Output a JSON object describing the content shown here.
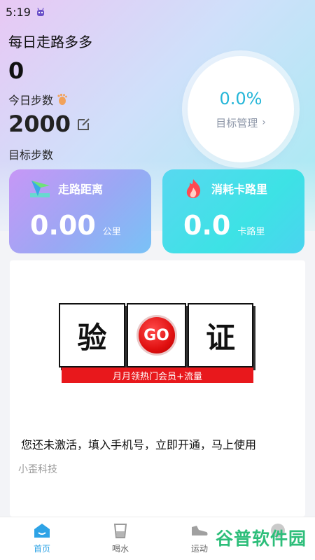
{
  "status_bar": {
    "time": "5:19"
  },
  "header": {
    "app_title": "每日走路多多",
    "steps_today": "0",
    "steps_today_label": "今日步数",
    "target_steps": "2000",
    "target_steps_label": "目标步数"
  },
  "goal": {
    "percent": "0.0%",
    "manage_label": "目标管理",
    "chevron": "›"
  },
  "cards": {
    "distance": {
      "title": "走路距离",
      "value": "0.00",
      "unit": "公里"
    },
    "calories": {
      "title": "消耗卡路里",
      "value": "0.0",
      "unit": "卡路里"
    }
  },
  "verify": {
    "char_left": "验",
    "go_text": "GO",
    "char_right": "证",
    "strip_text": "月月领热门会员+流量"
  },
  "activation": {
    "message": "您还未激活，填入手机号，立即开通，马上使用",
    "company": "小歪科技"
  },
  "tabs": [
    {
      "label": "首页",
      "active": true
    },
    {
      "label": "喝水",
      "active": false
    },
    {
      "label": "运动",
      "active": false
    },
    {
      "label": "",
      "active": false
    }
  ],
  "watermark": {
    "text": "谷普软件园"
  },
  "colors": {
    "accent": "#25b6d8",
    "tab_active": "#2ea3e6",
    "banner_red": "#e8181c",
    "watermark_green": "#2dbe7a"
  },
  "icons": {
    "status": "android-bot-icon",
    "steps": "footprint-icon",
    "edit": "edit-icon",
    "distance": "navigation-arrow-icon",
    "calories": "flame-icon",
    "tab_home": "home-icon",
    "tab_water": "cup-icon",
    "tab_sport": "sneaker-icon",
    "tab_profile": "profile-icon"
  }
}
